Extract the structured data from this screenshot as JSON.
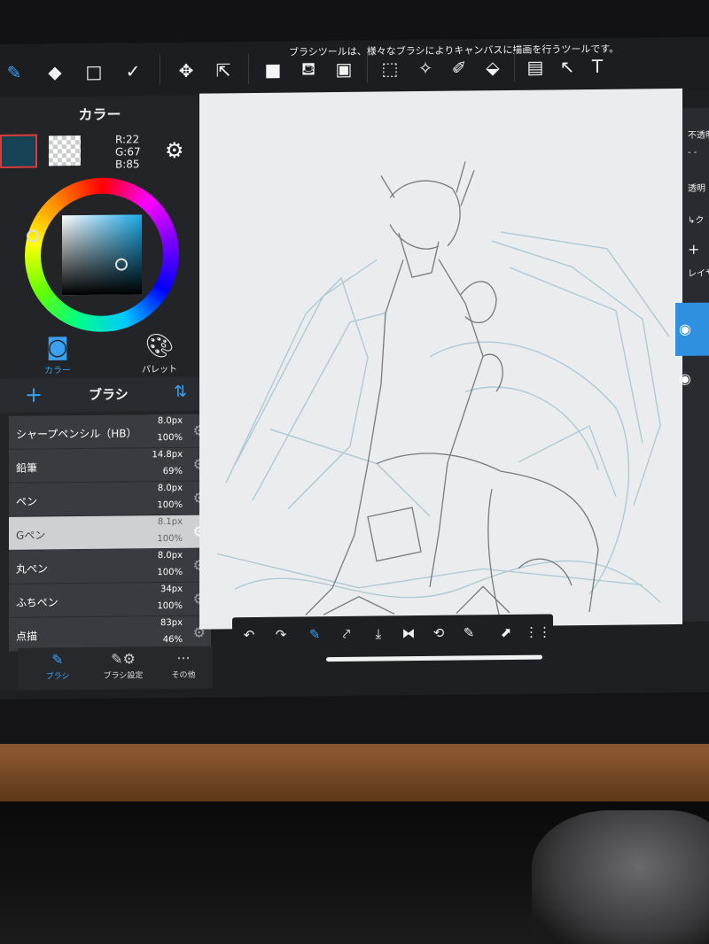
{
  "toolbar": {
    "tooltip": "ブラシツールは、様々なブラシによりキャンバスに描画を行うツールです。"
  },
  "color_panel": {
    "title": "カラー",
    "r": "R:22",
    "g": "G:67",
    "b": "B:85",
    "main_color": "#164355",
    "tab_color": "カラー",
    "tab_palette": "パレット"
  },
  "brush_panel": {
    "title": "ブラシ",
    "brushes": [
      {
        "name": "シャープペンシル（HB）",
        "size": "8.0px",
        "opacity": "100%"
      },
      {
        "name": "鉛筆",
        "size": "14.8px",
        "opacity": "69%"
      },
      {
        "name": "ペン",
        "size": "8.0px",
        "opacity": "100%"
      },
      {
        "name": "Gペン",
        "size": "8.1px",
        "opacity": "100%"
      },
      {
        "name": "丸ペン",
        "size": "8.0px",
        "opacity": "100%"
      },
      {
        "name": "ふちペン",
        "size": "34px",
        "opacity": "100%"
      },
      {
        "name": "点描",
        "size": "83px",
        "opacity": "46%"
      }
    ],
    "selected_index": 3,
    "tabs": {
      "brush": "ブラシ",
      "brush_settings": "ブラシ設定",
      "more": "その他"
    }
  },
  "layer_panel": {
    "opacity_label": "不透明",
    "transparent_label": "透明",
    "clip_label": "ク",
    "layer_label": "レイヤ"
  },
  "accent_color": "#3aa0f0"
}
